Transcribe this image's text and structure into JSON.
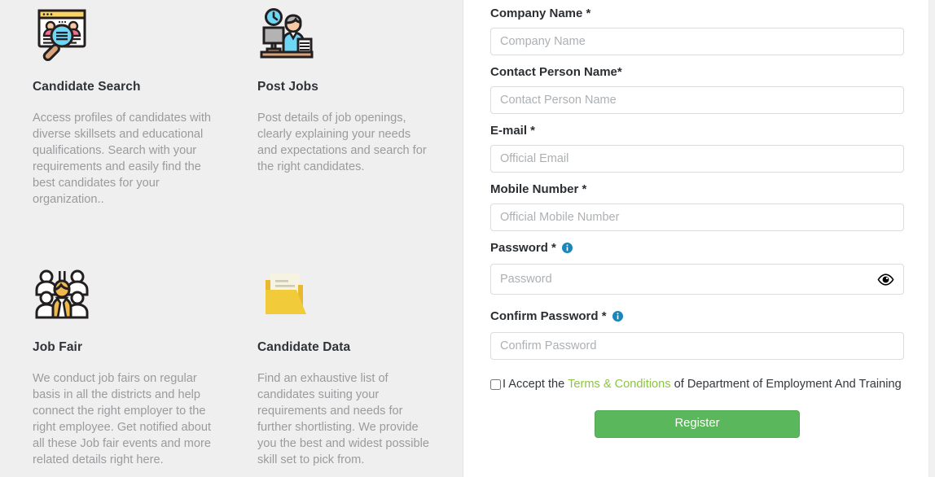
{
  "features": [
    {
      "icon": "candidate-search-icon",
      "title": "Candidate Search",
      "description": "Access profiles of candidates with diverse skillsets and educational qualifications. Search with your requirements and easily find the best candidates for your organization.."
    },
    {
      "icon": "post-jobs-icon",
      "title": "Post Jobs",
      "description": "Post details of job openings, clearly explaining your needs and expectations and search for the right candidates."
    },
    {
      "icon": "job-fair-icon",
      "title": "Job Fair",
      "description": "We conduct job fairs on regular basis in all the districts and help connect the right employer to the right employee. Get notified about all these Job fair events and more related details right here."
    },
    {
      "icon": "candidate-data-icon",
      "title": "Candidate Data",
      "description": "Find an exhaustive list of candidates suiting your requirements and needs for further shortlisting. We provide you the best and widest possible skill set to pick from."
    }
  ],
  "form": {
    "fields": [
      {
        "label": "Company Name *",
        "placeholder": "Company Name",
        "value": "",
        "type": "text",
        "info": false
      },
      {
        "label": "Contact Person Name*",
        "placeholder": "Contact Person Name",
        "value": "",
        "type": "text",
        "info": false
      },
      {
        "label": "E-mail *",
        "placeholder": "Official Email",
        "value": "",
        "type": "text",
        "info": false
      },
      {
        "label": "Mobile Number *",
        "placeholder": "Official Mobile Number",
        "value": "",
        "type": "text",
        "info": false
      },
      {
        "label": "Password *",
        "placeholder": "Password",
        "value": "",
        "type": "password",
        "info": true
      },
      {
        "label": "Confirm Password *",
        "placeholder": "Confirm Password",
        "value": "",
        "type": "password",
        "info": true
      }
    ],
    "terms": {
      "checked": false,
      "prefix": "I Accept the ",
      "link": "Terms & Conditions",
      "suffix": " of Department of Employment And Training"
    },
    "register_label": "Register"
  },
  "colors": {
    "panel_bg": "#efeff0",
    "accent_green": "#5bb75b",
    "link_green": "#8cc63f",
    "info_blue": "#1b87b9",
    "label_text": "#2b2f33",
    "muted_text": "#9b9b9e"
  }
}
